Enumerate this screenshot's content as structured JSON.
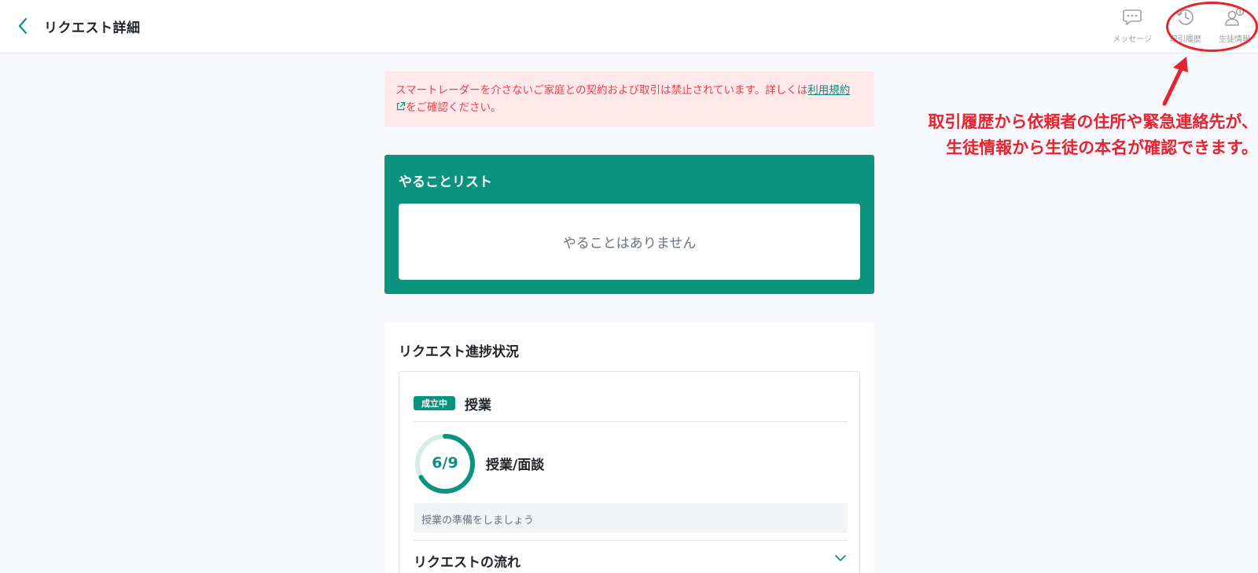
{
  "header": {
    "title": "リクエスト詳細",
    "actions": [
      {
        "label": "メッセージ",
        "icon": "chat-bubble-icon"
      },
      {
        "label": "取引履歴",
        "icon": "history-icon"
      },
      {
        "label": "生徒情報",
        "icon": "person-info-icon"
      }
    ]
  },
  "alert": {
    "text_before": "スマートレーダーを介さないご家庭との契約および取引は禁止されています。詳しくは",
    "link_text": "利用規約",
    "text_after": "をご確認ください。"
  },
  "todo": {
    "title": "やることリスト",
    "empty_text": "やることはありません"
  },
  "progress": {
    "title": "リクエスト進捗状況",
    "badge": "成立中",
    "lesson_title": "授業",
    "ring_text": "6/9",
    "ring_fraction": 0.667,
    "ring_label": "授業/面談",
    "hint": "授業の準備をしましょう",
    "flow_title": "リクエストの流れ"
  },
  "annotation": {
    "line1": "取引履歴から依頼者の住所や緊急連絡先が、",
    "line2": "生徒情報から生徒の本名が確認できます。"
  },
  "colors": {
    "primary": "#0c9380",
    "alert_bg": "#ffe9ea",
    "alert_text": "#e8414f",
    "annotation": "#e8222e"
  }
}
